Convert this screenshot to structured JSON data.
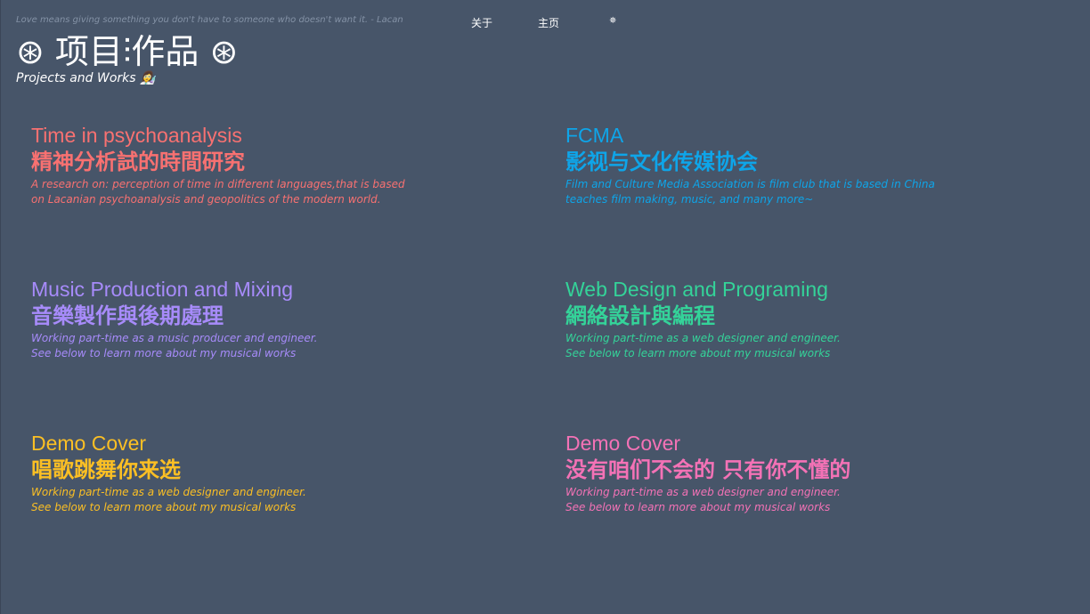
{
  "header": {
    "quote": "Love means giving something you don't have to someone who doesn't want it. - Lacan",
    "nav": {
      "about": "关于",
      "home": "主页",
      "settings_icon_glyph": "✵"
    },
    "title": "⊛ 项目⫶作品 ⊛",
    "subtitle": "Projects and Works 👩‍🔬"
  },
  "projects": [
    {
      "title_en": "Time in psychoanalysis",
      "title_zh": "精神分析試的時間研究",
      "desc_line1": "A research on: perception of time in different languages,that is based",
      "desc_line2": "on Lacanian psychoanalysis and geopolitics of the modern world.",
      "color": "#f87171"
    },
    {
      "title_en": "FCMA",
      "title_zh": "影视与文化传媒协会",
      "desc_line1": "Film and Culture Media Association is film club that is based in China",
      "desc_line2": "teaches film making, music, and many more~",
      "color": "#0ea5e9"
    },
    {
      "title_en": "Music Production and Mixing",
      "title_zh": "音樂製作與後期處理",
      "desc_line1": "Working part-time as a music producer and engineer.",
      "desc_line2": "See below to learn more about my musical works",
      "color": "#a78bfa"
    },
    {
      "title_en": "Web Design and Programing",
      "title_zh": "網絡設計與編程",
      "desc_line1": "Working part-time as a web designer and engineer.",
      "desc_line2": "See below to learn more about my musical works",
      "color": "#34d399"
    },
    {
      "title_en": "Demo Cover",
      "title_zh": "唱歌跳舞你来选",
      "desc_line1": "Working part-time as a web designer and engineer.",
      "desc_line2": "See below to learn more about my musical works",
      "color": "#fbbf24"
    },
    {
      "title_en": "Demo Cover",
      "title_zh": "没有咱们不会的 只有你不懂的",
      "desc_line1": "Working part-time as a web designer and engineer.",
      "desc_line2": "See below to learn more about my musical works",
      "color": "#f472b6"
    }
  ],
  "colors": {
    "background": "#475569",
    "text": "#ffffff",
    "quote": "#8492a6"
  }
}
